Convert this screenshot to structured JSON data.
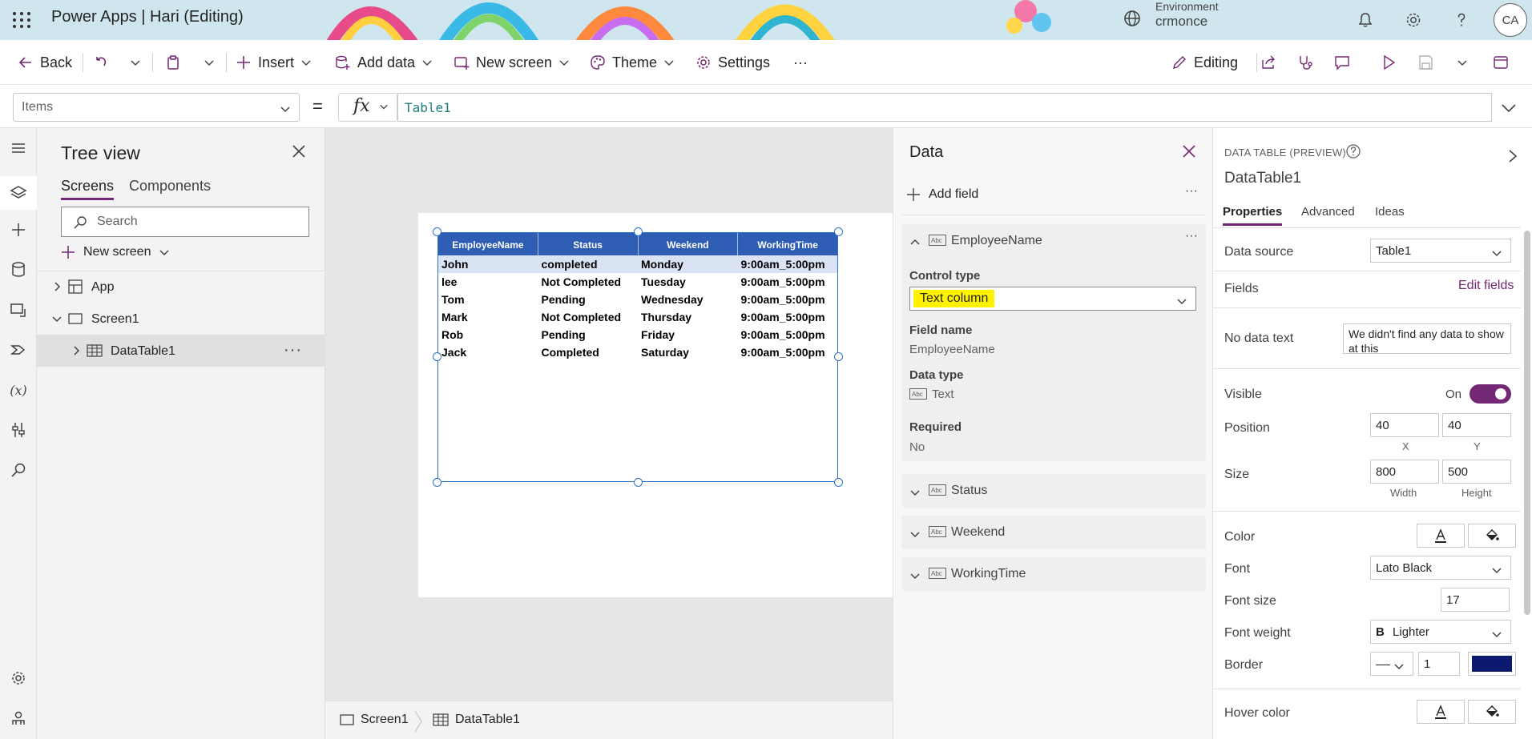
{
  "header": {
    "app_title": "Power Apps  |  Hari (Editing)",
    "environment_label": "Environment",
    "environment_name": "crmonce",
    "avatar_initials": "CA"
  },
  "command_bar": {
    "back": "Back",
    "insert": "Insert",
    "add_data": "Add data",
    "new_screen": "New screen",
    "theme": "Theme",
    "settings": "Settings",
    "more": "···",
    "editing": "Editing"
  },
  "formula_bar": {
    "property": "Items",
    "equals": "=",
    "fx": "fx",
    "formula": "Table1"
  },
  "tree_view": {
    "title": "Tree view",
    "tabs": [
      "Screens",
      "Components"
    ],
    "search_placeholder": "Search",
    "new_screen": "New screen",
    "items": {
      "app": "App",
      "screen": "Screen1",
      "datatable": "DataTable1"
    },
    "more": "···"
  },
  "data_table": {
    "columns": [
      "EmployeeName",
      "Status",
      "Weekend",
      "WorkingTime"
    ],
    "rows": [
      [
        "John",
        "completed",
        "Monday",
        "9:00am_5:00pm"
      ],
      [
        "lee",
        "Not Completed",
        "Tuesday",
        "9:00am_5:00pm"
      ],
      [
        "Tom",
        "Pending",
        "Wednesday",
        "9:00am_5:00pm"
      ],
      [
        "Mark",
        "Not Completed",
        "Thursday",
        "9:00am_5:00pm"
      ],
      [
        "Rob",
        "Pending",
        "Friday",
        "9:00am_5:00pm"
      ],
      [
        "Jack",
        "Completed",
        "Saturday",
        "9:00am_5:00pm"
      ]
    ]
  },
  "breadcrumb": {
    "screen": "Screen1",
    "control": "DataTable1"
  },
  "data_panel": {
    "title": "Data",
    "add_field": "Add field",
    "more": "···",
    "expanded_field": {
      "name": "EmployeeName",
      "control_type_label": "Control type",
      "control_type_value": "Text column",
      "field_name_label": "Field name",
      "field_name_value": "EmployeeName",
      "data_type_label": "Data type",
      "data_type_value": "Text",
      "required_label": "Required",
      "required_value": "No"
    },
    "collapsed_fields": [
      "Status",
      "Weekend",
      "WorkingTime"
    ]
  },
  "properties_panel": {
    "kind": "DATA TABLE (PREVIEW)",
    "name": "DataTable1",
    "tabs": [
      "Properties",
      "Advanced",
      "Ideas"
    ],
    "data_source_label": "Data source",
    "data_source_value": "Table1",
    "fields_label": "Fields",
    "edit_fields": "Edit fields",
    "no_data_text_label": "No data text",
    "no_data_text_value": "We didn't find any data to show at this",
    "visible_label": "Visible",
    "visible_value": "On",
    "position_label": "Position",
    "position_x": "40",
    "position_y": "40",
    "x_label": "X",
    "y_label": "Y",
    "size_label": "Size",
    "width_value": "800",
    "height_value": "500",
    "width_label": "Width",
    "height_label": "Height",
    "color_label": "Color",
    "font_label": "Font",
    "font_value": "Lato Black",
    "font_size_label": "Font size",
    "font_size_value": "17",
    "font_weight_label": "Font weight",
    "font_weight_value": "Lighter",
    "border_label": "Border",
    "border_width": "1",
    "border_color": "#0b1a6e",
    "hover_color_label": "Hover color"
  },
  "colors": {
    "accent": "#742774",
    "table_header": "#2f5db4",
    "selection": "#2a74c9",
    "highlight": "#fff200"
  }
}
